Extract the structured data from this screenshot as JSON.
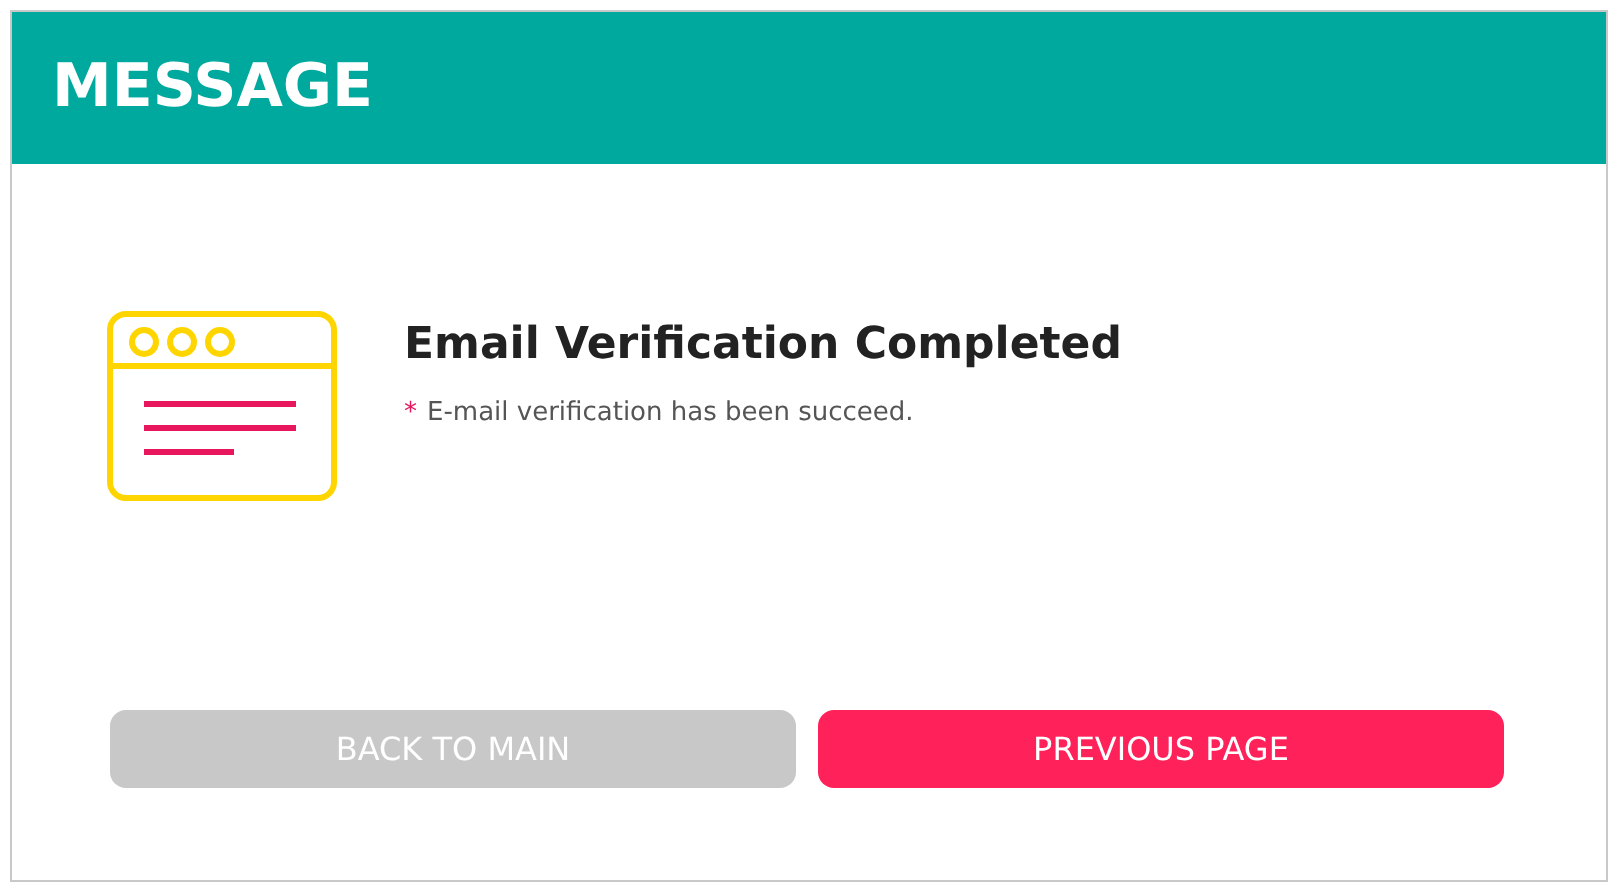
{
  "header": {
    "title": "MESSAGE"
  },
  "message": {
    "title": "Email Verification Completed",
    "marker": "*",
    "text": "E-mail verification has been succeed."
  },
  "buttons": [
    {
      "label": "BACK TO MAIN",
      "kind": "secondary"
    },
    {
      "label": "PREVIOUS PAGE",
      "kind": "primary"
    }
  ]
}
